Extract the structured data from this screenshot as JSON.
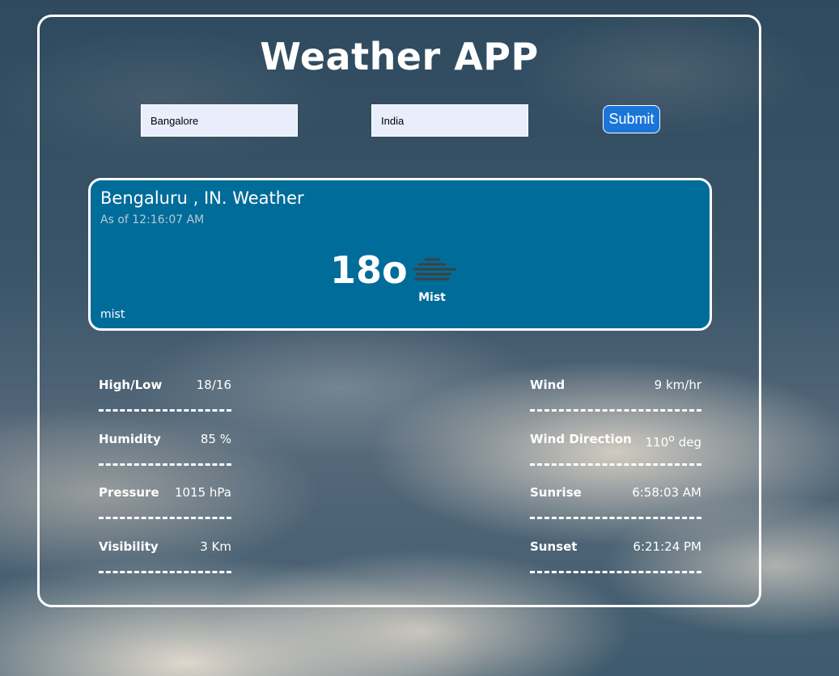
{
  "app": {
    "title": "Weather APP"
  },
  "form": {
    "city_value": "Bangalore",
    "country_value": "India",
    "submit_label": "Submit"
  },
  "current": {
    "location": "Bengaluru , IN. Weather",
    "as_of": "As of 12:16:07 AM",
    "temperature": "18",
    "degree_symbol": "o",
    "condition": "Mist",
    "condition_icon": "mist-icon",
    "description": "mist"
  },
  "stats_left": [
    {
      "label": "High/Low",
      "value": "18/16"
    },
    {
      "label": "Humidity",
      "value": "85 %"
    },
    {
      "label": "Pressure",
      "value": "1015 hPa"
    },
    {
      "label": "Visibility",
      "value": "3 Km"
    }
  ],
  "stats_right": [
    {
      "label": "Wind",
      "value": "9 km/hr"
    },
    {
      "label": "Wind Direction",
      "value_number": "110",
      "value_unit": "deg"
    },
    {
      "label": "Sunrise",
      "value": "6:58:03 AM"
    },
    {
      "label": "Sunset",
      "value": "6:21:24 PM"
    }
  ],
  "colors": {
    "card_bg": "#006c9a",
    "input_bg": "#e8eefc",
    "button_bg": "#1a75d9",
    "border": "#ffffff"
  }
}
